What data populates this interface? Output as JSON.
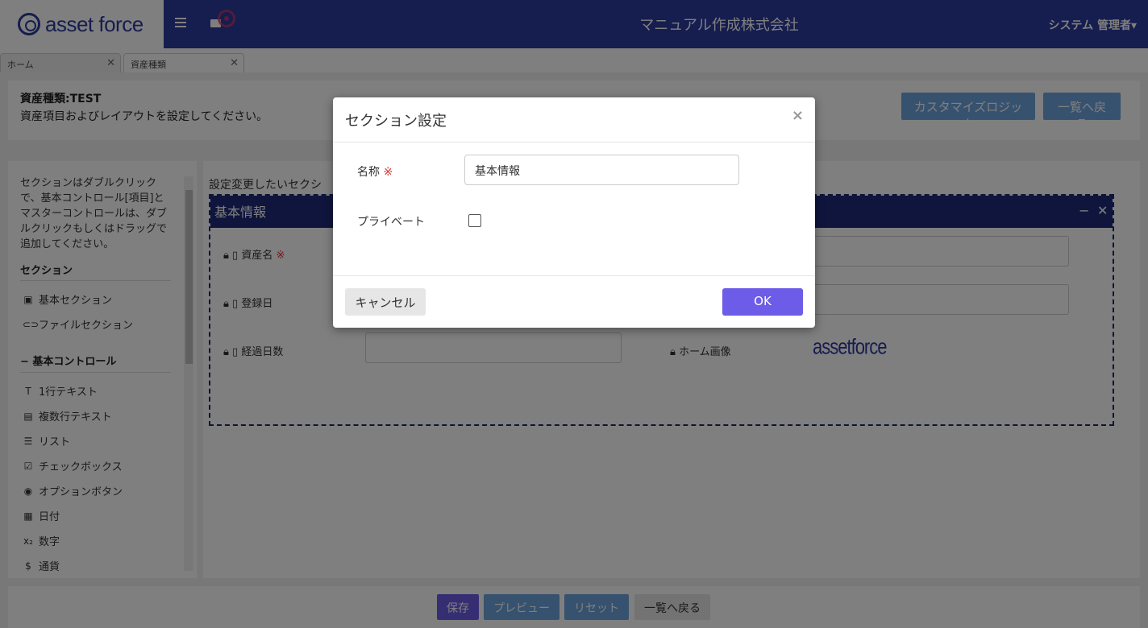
{
  "app": {
    "logo_text": "asset force",
    "company": "マニュアル作成株式会社",
    "user": "システム 管理者"
  },
  "tabs": [
    {
      "label": "ホーム"
    },
    {
      "label": "資産種類"
    }
  ],
  "header": {
    "title": "資産種類:TEST",
    "description": "資産項目およびレイアウトを設定してください。",
    "customize_button": "カスタマイズロジック",
    "back_button": "一覧へ戻る"
  },
  "left_panel": {
    "hint": "セクションはダブルクリックで、基本コントロール[項目]とマスターコントロールは、ダブルクリックもしくはドラッグで追加してください。",
    "section_heading": "セクション",
    "section_items": [
      "基本セクション",
      "ファイルセクション"
    ],
    "basic_heading": "− 基本コントロール",
    "basic_items": [
      "1行テキスト",
      "複数行テキスト",
      "リスト",
      "チェックボックス",
      "オプションボタン",
      "日付",
      "数字",
      "通貨"
    ]
  },
  "main": {
    "select_label": "設定変更したいセクシ",
    "section_name": "基本情報",
    "fields": [
      {
        "label": "資産名",
        "required": "※"
      },
      {
        "label": "登録日"
      },
      {
        "label": "経過日数"
      },
      {
        "label": "ホーム画像"
      }
    ],
    "mini_logo": "assetforce"
  },
  "bottom": {
    "save": "保存",
    "preview": "プレビュー",
    "reset": "リセット",
    "back": "一覧へ戻る"
  },
  "modal": {
    "title": "セクション設定",
    "close": "×",
    "name_label": "名称",
    "required_mark": "※",
    "name_value": "基本情報",
    "private_label": "プライベート",
    "private_checked": false,
    "cancel": "キャンセル",
    "ok": "OK"
  },
  "colors": {
    "brand": "#2d3a9e",
    "section_header": "#1f2b7a",
    "accent_button": "#6ea5de",
    "ok_button": "#6c5ce7",
    "save_button": "#6c5ce7"
  }
}
